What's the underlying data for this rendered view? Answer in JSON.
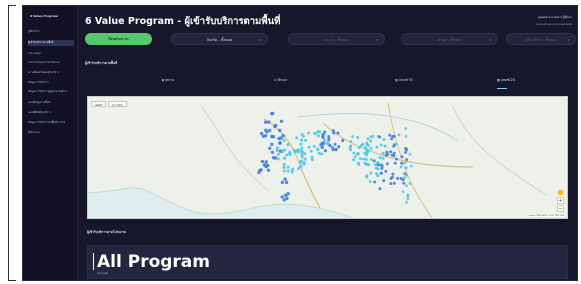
{
  "app": {
    "logo": "6 Value Program"
  },
  "sidebar": {
    "items": [
      {
        "label": "ผู้ใช้บริการ"
      },
      {
        "label": "ผู้เข้ารับบริการตามพื้นที่"
      },
      {
        "label": "รายงานสรุป"
      },
      {
        "label": "การประเมินผลการดำเนินงาน"
      },
      {
        "label": "ความพึงพอใจของผู้รับบริการ"
      },
      {
        "label": "ข้อมูลการให้บริการ"
      },
      {
        "label": "ข้อมูลการให้บริการผู้สูงอายุ คนพิการ"
      },
      {
        "label": "แผนที่ข้อมูลรายพื้นที่"
      },
      {
        "label": "แผนที่พิกัดผู้รับบริการ"
      },
      {
        "label": "ข้อมูลการให้บริการในพื้นที่ห่างไกล"
      },
      {
        "label": "ตั้งค่าระบบ"
      }
    ]
  },
  "header": {
    "title": "6 Value Program - ผู้เข้ารับบริการตามพื้นที่",
    "user_name": "คุณสมชาย ณ ชลธาร ผู้ใช้งาน",
    "user_role": "หน่วยงานส่วนกลาง สาธารณสุขจังหวัด"
  },
  "filters": {
    "chip1": "ปีงบประมาณ",
    "chip2": "จังหวัด - ทั้งหมด",
    "chip3": "อำเภอ - ทั้งหมด",
    "chip4": "ตำบล - ทั้งหมด",
    "chip5": "ผู้รับบริการ - ทั้งหมด",
    "chevron": "▾"
  },
  "map_section": {
    "title": "ผู้เข้ารับบริการตามพื้นที่",
    "tabs": [
      "ทุกราย",
      "ที่กรอก",
      "เกณฑ์ 30",
      "เกณฑ์ 25"
    ],
    "map_buttons": [
      "แผนที่",
      "ดาวเทียม"
    ],
    "zoom_in": "+",
    "zoom_out": "−",
    "attribution": "Google  ข้อมูลแผนที่ ©2021  ข้อกำหนด"
  },
  "program_section": {
    "title": "ผู้เข้ารับบริการตามโปรแกรม",
    "program_title": "All Program",
    "program_sub": "จำนวนคน"
  },
  "colors": {
    "app_bg": "#17172b",
    "sidebar_bg": "#121224",
    "accent_green": "#57c86d",
    "map_water": "#dfeeed",
    "map_land": "#eef0ea",
    "dot_blue": "#3b7de2",
    "dot_cyan": "#45c6ed"
  },
  "icons": {
    "tab1": "bar-chart-icon",
    "tab2": "list-icon",
    "tab3": "map-icon",
    "tab4": "map-icon"
  }
}
